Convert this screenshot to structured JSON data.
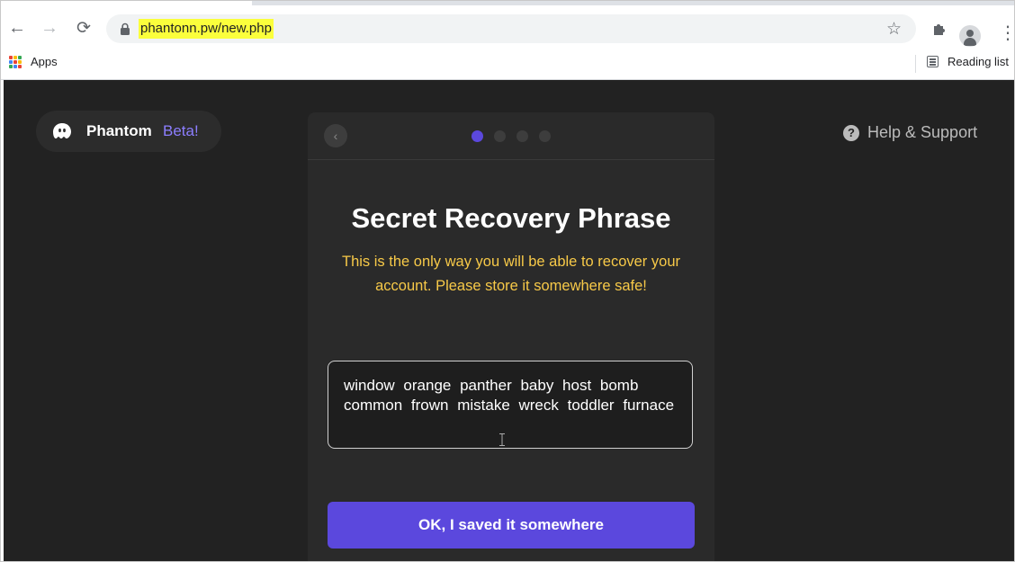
{
  "browser": {
    "address": "phantonn.pw/new.php",
    "bookmarks": {
      "apps_label": "Apps",
      "reading_list_label": "Reading list"
    },
    "highlight_color": "#fbff3c"
  },
  "page": {
    "brand": {
      "name": "Phantom",
      "badge": "Beta!"
    },
    "help_label": "Help & Support",
    "stepper": {
      "current_step": 1,
      "total_steps": 4
    },
    "title": "Secret Recovery Phrase",
    "warning": "This is the only way you will be able to recover your account. Please store it somewhere safe!",
    "recovery_phrase": "window orange panther baby host bomb common frown mistake wreck toddler furnace",
    "confirm_button": "OK, I saved it somewhere"
  },
  "colors": {
    "background": "#222222",
    "card": "#2a2a2a",
    "accent": "#5b48dd",
    "warning_text": "#f7c948",
    "beta_badge": "#8c7eff"
  }
}
